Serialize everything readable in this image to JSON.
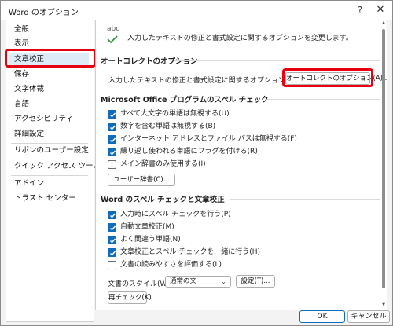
{
  "window": {
    "title": "Word のオプション",
    "help_icon": "?",
    "close_icon": "✕"
  },
  "sidebar": {
    "items": [
      {
        "label": "全般"
      },
      {
        "label": "表示"
      },
      {
        "label": "文章校正"
      },
      {
        "label": "保存"
      },
      {
        "label": "文字体裁"
      },
      {
        "label": "言語"
      },
      {
        "label": "アクセシビリティ"
      },
      {
        "label": "詳細設定"
      },
      {
        "label": "リボンのユーザー設定"
      },
      {
        "label": "クイック アクセス ツール バー"
      },
      {
        "label": "アドイン"
      },
      {
        "label": "トラスト センター"
      }
    ],
    "active_index": 2
  },
  "main": {
    "intro_icon_text": "abc",
    "intro": "入力したテキストの修正と書式設定に関するオプションを変更します。",
    "autocorrect": {
      "heading": "オートコレクトのオプション",
      "description": "入力したテキストの修正と書式設定に関するオプションを変更します。",
      "button": "オートコレクトのオプション(A)..."
    },
    "office_spell": {
      "heading": "Microsoft Office プログラムのスペル チェック",
      "options": [
        {
          "label": "すべて大文字の単語は無視する(U)",
          "checked": true
        },
        {
          "label": "数字を含む単語は無視する(B)",
          "checked": true
        },
        {
          "label": "インターネット アドレスとファイル パスは無視する(F)",
          "checked": true
        },
        {
          "label": "繰り返し使われる単語にフラグを付ける(R)",
          "checked": true
        },
        {
          "label": "メイン辞書のみ使用する(I)",
          "checked": false
        }
      ],
      "dictionary_button": "ユーザー辞書(C)..."
    },
    "word_spell": {
      "heading": "Word のスペル チェックと文章校正",
      "options": [
        {
          "label": "入力時にスペル チェックを行う(P)",
          "checked": true
        },
        {
          "label": "自動文章校正(M)",
          "checked": true
        },
        {
          "label": "よく間違う単語(N)",
          "checked": true
        },
        {
          "label": "文章校正とスペル チェックを一緒に行う(H)",
          "checked": true
        },
        {
          "label": "文書の読みやすさを評価する(L)",
          "checked": false
        }
      ],
      "style_label": "文書のスタイル(W):",
      "style_value": "通常の文",
      "settings_button": "設定(T)...",
      "recheck_button": "再チェック(K)"
    }
  },
  "footer": {
    "ok": "OK",
    "cancel": "キャンセル"
  },
  "colors": {
    "highlight_box": "#e60012",
    "checkbox_checked": "#0f6cbd",
    "active_item": "#ddeaf7"
  }
}
